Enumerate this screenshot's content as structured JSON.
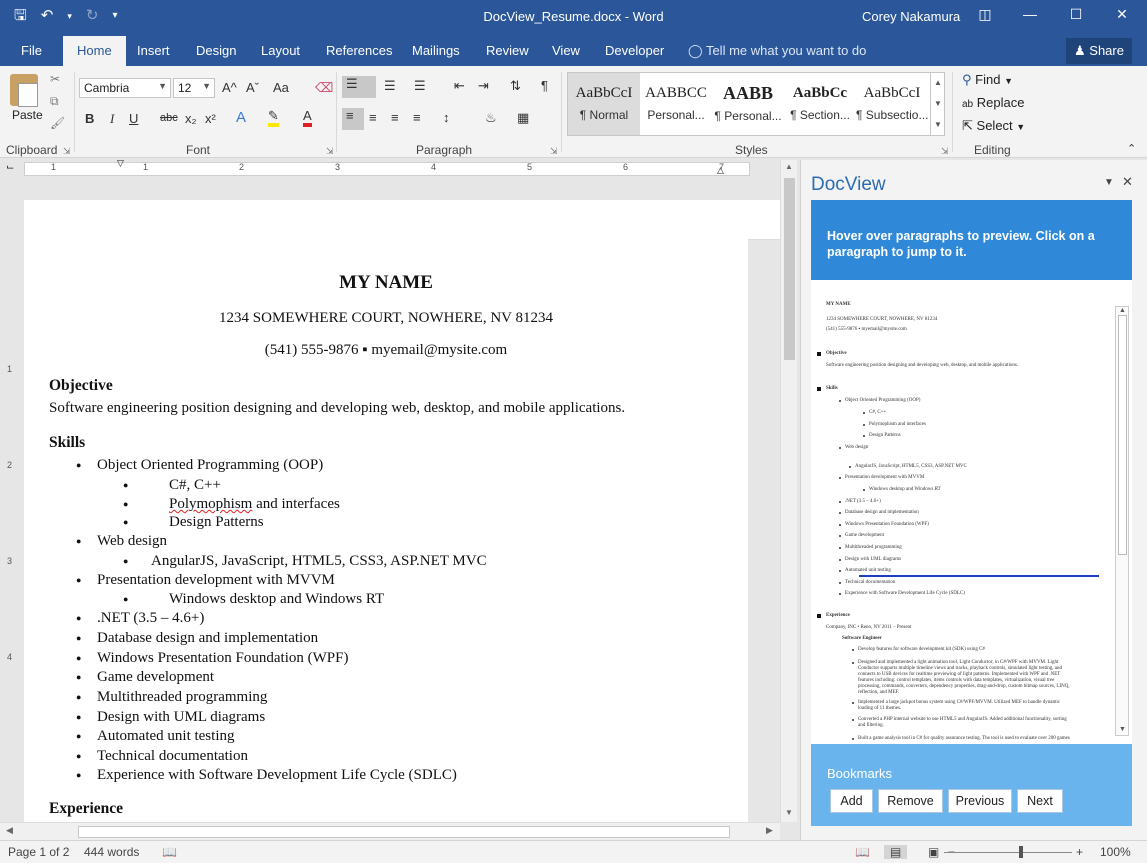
{
  "window": {
    "title": "DocView_Resume.docx - Word",
    "user": "Corey Nakamura"
  },
  "qat": {
    "save": "save-icon",
    "undo": "undo-icon",
    "redo": "redo-icon",
    "customize": "customize-icon"
  },
  "tabs": [
    "File",
    "Home",
    "Insert",
    "Design",
    "Layout",
    "References",
    "Mailings",
    "Review",
    "View",
    "Developer"
  ],
  "tell_me": "Tell me what you want to do",
  "share_label": "Share",
  "ribbon": {
    "clipboard": {
      "paste": "Paste",
      "label": "Clipboard"
    },
    "font": {
      "name": "Cambria",
      "size": "12",
      "label": "Font",
      "bold": "B",
      "italic": "I",
      "underline": "U",
      "strike": "abc",
      "sub": "x₂",
      "sup": "x²",
      "grow": "A^",
      "shrink": "Aˇ",
      "case": "Aa"
    },
    "paragraph": {
      "label": "Paragraph",
      "pilcrow": "¶"
    },
    "styles": {
      "label": "Styles",
      "items": [
        {
          "sample": "AaBbCcI",
          "name": "¶ Normal"
        },
        {
          "sample": "AABBCC",
          "name": "Personal..."
        },
        {
          "sample": "AABB",
          "name": "¶ Personal..."
        },
        {
          "sample": "AaBbCc",
          "name": "¶ Section..."
        },
        {
          "sample": "AaBbCcI",
          "name": "¶ Subsectio..."
        }
      ]
    },
    "editing": {
      "label": "Editing",
      "find": "Find",
      "replace": "Replace",
      "select": "Select"
    }
  },
  "ruler_numbers": [
    "1",
    "1",
    "2",
    "3",
    "4",
    "5",
    "6",
    "7"
  ],
  "vruler_numbers": [
    "1",
    "2",
    "3",
    "4"
  ],
  "document": {
    "name": "MY NAME",
    "address": "1234 SOMEWHERE COURT, NOWHERE, NV 81234",
    "contact": "(541) 555-9876  ▪  myemail@mysite.com",
    "objective_heading": "Objective",
    "objective_text": "Software engineering position designing and developing web, desktop, and mobile applications.",
    "skills_heading": "Skills",
    "skills": {
      "oop": "Object Oriented Programming (OOP)",
      "csharp": "C#, C++",
      "poly_a": "Polymophism",
      "poly_b": " and interfaces",
      "patterns": "Design Patterns",
      "web": "Web design",
      "angular": "AngularJS, JavaScript, HTML5, CSS3, ASP.NET MVC",
      "mvvm": "Presentation development with MVVM",
      "windows": "Windows desktop and Windows RT",
      "dotnet": ".NET (3.5 – 4.6+)",
      "database": "Database design and implementation",
      "wpf": "Windows Presentation Foundation (WPF)",
      "game": "Game development",
      "multi": "Multithreaded programming",
      "uml": "Design with UML diagrams",
      "unit": "Automated unit testing",
      "tech": "Technical documentation",
      "sdlc": "Experience with Software Development Life Cycle (SDLC)"
    },
    "experience_heading": "Experience"
  },
  "docview": {
    "title": "DocView",
    "banner": "Hover over paragraphs to preview. Click on a paragraph to jump to it.",
    "preview": {
      "name": "MY NAME",
      "address": "1234 SOMEWHERE COURT, NOWHERE, NV 81234",
      "contact": "(541) 555-9876 ▪ myemail@mysite.com",
      "objective": "Objective",
      "objective_text": "Software engineering position designing and developing web, desktop, and mobile applications.",
      "skills": "Skills",
      "skill_lines": [
        "Object Oriented Programming (OOP)",
        "C#, C++",
        "Polymophism and interfaces",
        "Design Patterns",
        "Web design",
        "AngularJS, JavaScript, HTML5, CSS3, ASP.NET MVC",
        "Presentation development with MVVM",
        "Windows desktop and Windows RT",
        ".NET (3.5 – 4.6+)",
        "Database design and implementation",
        "Windows Presentation Foundation (WPF)",
        "Game development",
        "Multithreaded programming",
        "Design with UML diagrams",
        "Automated unit testing",
        "Technical documentation",
        "Experience with Software Development Life Cycle (SDLC)"
      ],
      "experience": "Experience",
      "company": "Company, INC • Reno, NV 2011 – Present",
      "role": "Software Engineer",
      "exp_lines": [
        "Develop features for software development kit (SDK) using C#",
        "Designed and implemented a light animation tool, Light Conductor, in C#/WPF with MVVM. Light",
        "Conductor supports multiple timeline views and tracks, playback controls, simulated light testing, and",
        "connects to USB devices for realtime previewing of light patterns. Implemented with WPF and .NET",
        "features including: control templates, items controls with data templates, virtualization, visual tree",
        "processing, commands, converters, dependency properties, drag-and-drop, custom bitmap sources, LINQ,",
        "reflection, and MEF.",
        "Implemented a large jackpot bonus system using C#/WPF/MVVM. Utilized MEF to handle dynamic",
        "loading of 11 themes.",
        "Converted a PHP internal website to use HTML5 and AngularJS. Added additional functionality, sorting",
        "and filtering.",
        "Built a game analysis tool in C# for quality assurance testing. The tool is used to evaluate over 200 games"
      ]
    },
    "bookmarks": {
      "title": "Bookmarks",
      "add": "Add",
      "remove": "Remove",
      "previous": "Previous",
      "next": "Next"
    }
  },
  "status": {
    "page": "Page 1 of 2",
    "words": "444 words",
    "zoom": "100%"
  }
}
